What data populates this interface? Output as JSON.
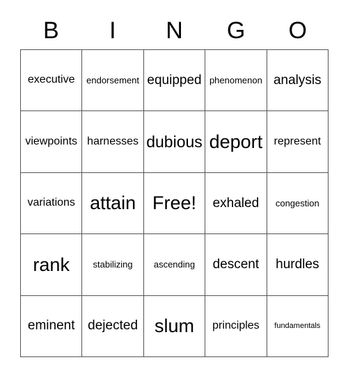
{
  "card": {
    "header_letters": [
      "B",
      "I",
      "N",
      "G",
      "O"
    ],
    "free_space_label": "Free!",
    "grid_line_color": "#555555",
    "text_color": "#000000",
    "background_color": "#ffffff",
    "rows": [
      [
        {
          "text": "executive",
          "size": "fs-m"
        },
        {
          "text": "endorsement",
          "size": "fs-s"
        },
        {
          "text": "equipped",
          "size": "fs-l"
        },
        {
          "text": "phenomenon",
          "size": "fs-s"
        },
        {
          "text": "analysis",
          "size": "fs-l"
        }
      ],
      [
        {
          "text": "viewpoints",
          "size": "fs-m"
        },
        {
          "text": "harnesses",
          "size": "fs-m"
        },
        {
          "text": "dubious",
          "size": "fs-xl"
        },
        {
          "text": "deport",
          "size": "fs-xxl"
        },
        {
          "text": "represent",
          "size": "fs-m"
        }
      ],
      [
        {
          "text": "variations",
          "size": "fs-m"
        },
        {
          "text": "attain",
          "size": "fs-xxl"
        },
        {
          "text": "Free!",
          "size": "fs-xxl"
        },
        {
          "text": "exhaled",
          "size": "fs-l"
        },
        {
          "text": "congestion",
          "size": "fs-s"
        }
      ],
      [
        {
          "text": "rank",
          "size": "fs-xxl"
        },
        {
          "text": "stabilizing",
          "size": "fs-s"
        },
        {
          "text": "ascending",
          "size": "fs-s"
        },
        {
          "text": "descent",
          "size": "fs-l"
        },
        {
          "text": "hurdles",
          "size": "fs-l"
        }
      ],
      [
        {
          "text": "eminent",
          "size": "fs-l"
        },
        {
          "text": "dejected",
          "size": "fs-l"
        },
        {
          "text": "slum",
          "size": "fs-xxl"
        },
        {
          "text": "principles",
          "size": "fs-m"
        },
        {
          "text": "fundamentals",
          "size": "fs-xs"
        }
      ]
    ]
  }
}
